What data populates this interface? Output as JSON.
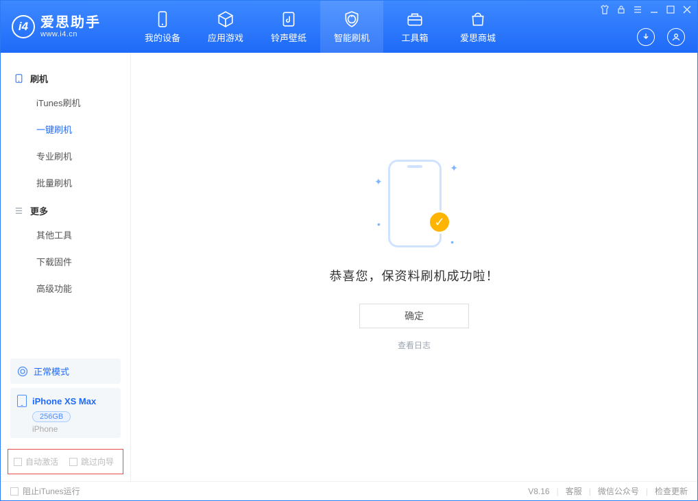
{
  "app": {
    "name_zh": "爱思助手",
    "name_en": "www.i4.cn"
  },
  "tabs": [
    {
      "label": "我的设备",
      "icon": "device"
    },
    {
      "label": "应用游戏",
      "icon": "cube"
    },
    {
      "label": "铃声壁纸",
      "icon": "music"
    },
    {
      "label": "智能刷机",
      "icon": "shield",
      "active": true
    },
    {
      "label": "工具箱",
      "icon": "toolbox"
    },
    {
      "label": "爱思商城",
      "icon": "bag"
    }
  ],
  "sidebar": {
    "groups": [
      {
        "title": "刷机",
        "icon": "phone",
        "items": [
          {
            "label": "iTunes刷机"
          },
          {
            "label": "一键刷机",
            "active": true
          },
          {
            "label": "专业刷机"
          },
          {
            "label": "批量刷机"
          }
        ]
      },
      {
        "title": "更多",
        "icon": "list",
        "items": [
          {
            "label": "其他工具"
          },
          {
            "label": "下载固件"
          },
          {
            "label": "高级功能"
          }
        ]
      }
    ],
    "mode": {
      "label": "正常模式"
    },
    "device": {
      "name": "iPhone XS Max",
      "storage": "256GB",
      "type": "iPhone"
    },
    "checks": [
      {
        "label": "自动激活"
      },
      {
        "label": "跳过向导"
      }
    ]
  },
  "main": {
    "headline": "恭喜您，保资料刷机成功啦！",
    "ok_btn": "确定",
    "log_link": "查看日志"
  },
  "statusbar": {
    "block_itunes": "阻止iTunes运行",
    "version": "V8.16",
    "links": [
      "客服",
      "微信公众号",
      "检查更新"
    ]
  }
}
